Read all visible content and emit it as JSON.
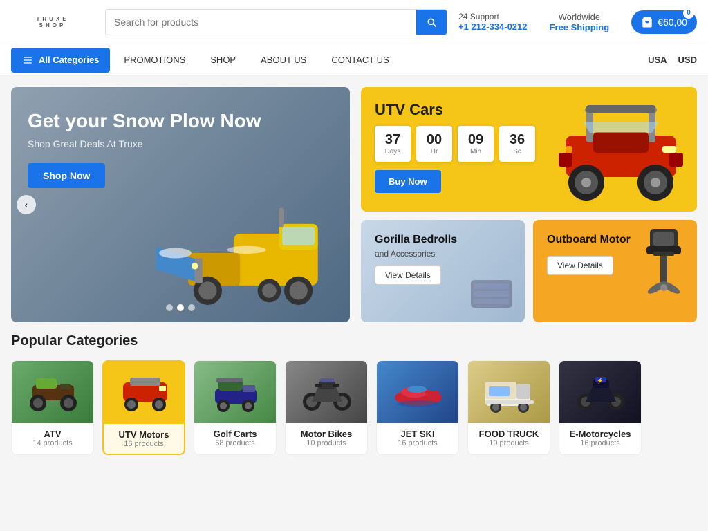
{
  "header": {
    "logo": "TRUXE",
    "logo_sub": "SHOP",
    "search_placeholder": "Search for products",
    "search_btn_label": "Search",
    "support_label": "24 Support",
    "support_phone": "+1 212-334-0212",
    "worldwide_title": "Worldwide",
    "worldwide_sub": "Free Shipping",
    "cart_count": "0",
    "cart_price": "€60,00"
  },
  "nav": {
    "categories_label": "All Categories",
    "links": [
      "PROMOTIONS",
      "SHOP",
      "ABOUT US",
      "CONTACT US"
    ],
    "region": "USA",
    "currency": "USD"
  },
  "hero": {
    "title": "Get your Snow Plow Now",
    "subtitle": "Shop Great Deals At Truxe",
    "btn_label": "Shop Now",
    "dots": [
      1,
      2,
      3
    ],
    "prev_btn": "‹"
  },
  "utv_banner": {
    "title": "UTV Cars",
    "countdown": {
      "days_label": "Days",
      "days_value": "37",
      "hr_label": "Hr",
      "hr_value": "00",
      "min_label": "Min",
      "min_value": "09",
      "sc_label": "Sc",
      "sc_value": "36"
    },
    "btn_label": "Buy Now"
  },
  "gorilla_banner": {
    "title": "Gorilla Bedrolls",
    "sub": "and Accessories",
    "btn_label": "View Details"
  },
  "outboard_banner": {
    "title": "Outboard Motor",
    "btn_label": "View Details"
  },
  "popular_categories": {
    "title": "Popular Categories",
    "items": [
      {
        "name": "ATV",
        "count": "14 products",
        "highlight": false,
        "emoji": "🏍"
      },
      {
        "name": "UTV Motors",
        "count": "16 products",
        "highlight": true,
        "emoji": "🚙"
      },
      {
        "name": "Golf Carts",
        "count": "68 products",
        "highlight": false,
        "emoji": "🛺"
      },
      {
        "name": "Motor Bikes",
        "count": "10 products",
        "highlight": false,
        "emoji": "🏍"
      },
      {
        "name": "JET SKI",
        "count": "16 products",
        "highlight": false,
        "emoji": "🚤"
      },
      {
        "name": "FOOD TRUCK",
        "count": "19 products",
        "highlight": false,
        "emoji": "🚚"
      },
      {
        "name": "E-Motorcycles",
        "count": "16 products",
        "highlight": false,
        "emoji": "⚡"
      }
    ]
  }
}
